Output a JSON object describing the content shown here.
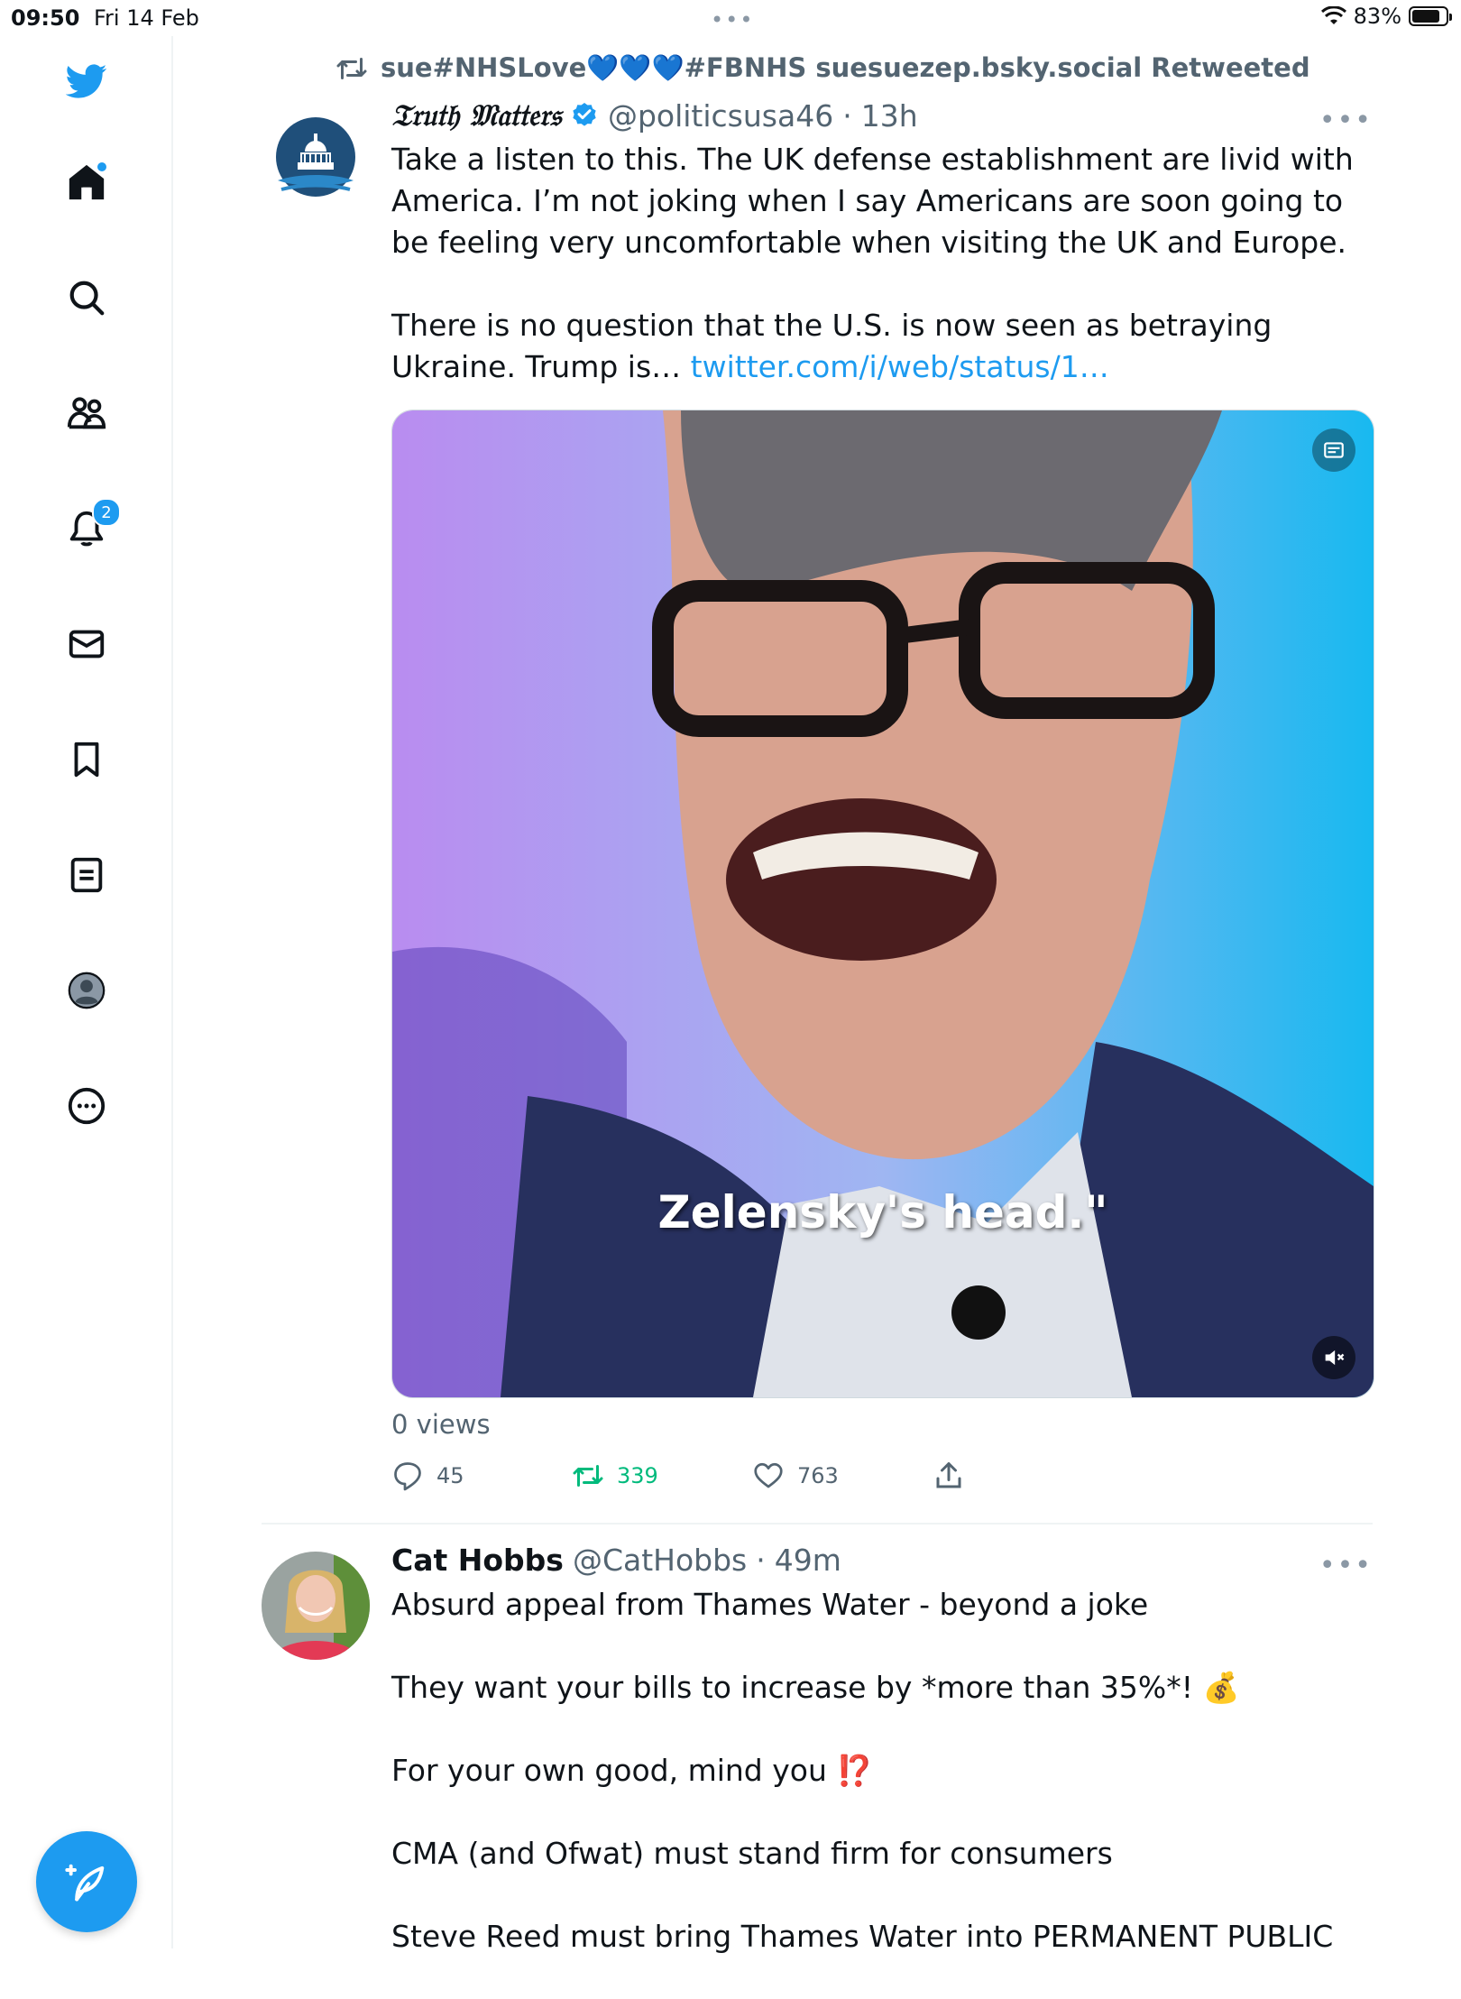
{
  "status_bar": {
    "time": "09:50",
    "date": "Fri 14 Feb",
    "dots": "•••",
    "battery": "83%",
    "battery_level": 0.83
  },
  "sidebar": {
    "notifications_count": "2",
    "items": [
      "home",
      "search",
      "communities",
      "notifications",
      "messages",
      "bookmarks",
      "lists",
      "profile",
      "more"
    ]
  },
  "tweets": [
    {
      "retweet_label": "sue#NHSLove💙💙💙#FBNHS suesuezep.bsky.social Retweeted",
      "name": "𝔗𝔯𝔲𝔱𝔥 𝔐𝔞𝔱𝔱𝔢𝔯𝔰",
      "handle": "@politicsusa46",
      "dot": "·",
      "time": "13h",
      "more": "•••",
      "text_p1": "Take a listen to this. The UK defense establishment are livid with America. I’m not joking when I say Americans are soon going to be feeling very uncomfortable when visiting the UK and Europe.",
      "text_p2_start": "There is no question that the U.S. is now seen as betraying Ukraine. Trump is…",
      "link": "twitter.com/i/web/status/1…",
      "media_caption": "Zelensky's head.\"",
      "views": "0 views",
      "replies": "45",
      "retweets": "339",
      "likes": "763"
    },
    {
      "name": "Cat Hobbs",
      "handle": "@CatHobbs",
      "dot": "·",
      "time": "49m",
      "more": "•••",
      "line1": "Absurd appeal from Thames Water - beyond a joke",
      "line2": "They want your bills to increase by *more than 35%*!  💰",
      "line3": "For your own good, mind you ⁉️",
      "line4": "CMA (and Ofwat) must stand firm for consumers",
      "line5": "Steve Reed must bring Thames Water into PERMANENT PUBLIC"
    }
  ],
  "colors": {
    "accent": "#1d9bf0",
    "retweet_green": "#00ba7c",
    "secondary_text": "#536471"
  }
}
